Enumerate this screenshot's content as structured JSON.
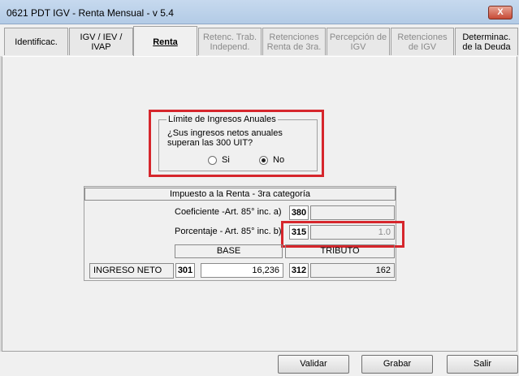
{
  "window": {
    "title": "0621 PDT IGV - Renta Mensual - v 5.4",
    "close_label": "X"
  },
  "tabs": [
    {
      "label": "Identificac."
    },
    {
      "label": "IGV / IEV / IVAP"
    },
    {
      "label": "Renta"
    },
    {
      "label": "Retenc. Trab. Independ."
    },
    {
      "label": "Retenciones Renta de 3ra."
    },
    {
      "label": "Percepción de IGV"
    },
    {
      "label": "Retenciones de IGV"
    },
    {
      "label": "Determinac. de la Deuda"
    }
  ],
  "limite": {
    "legend": "Límite de Ingresos Anuales",
    "question": "¿Sus ingresos netos anuales superan las 300 UIT?",
    "option_si": "Si",
    "option_no": "No",
    "selected": "No"
  },
  "impuesto": {
    "header": "Impuesto a la Renta - 3ra categoría",
    "coeficiente_label": "Coeficiente -Art. 85° inc. a)",
    "coeficiente_code": "380",
    "coeficiente_value": "",
    "porcentaje_label": "Porcentaje - Art. 85° inc. b)",
    "porcentaje_code": "315",
    "porcentaje_value": "1.0",
    "col_base": "BASE",
    "col_tributo": "TRIBUTO",
    "ingreso_label": "INGRESO NETO",
    "base_code": "301",
    "base_value": "16,236",
    "tributo_code": "312",
    "tributo_value": "162"
  },
  "buttons": {
    "validar": "Validar",
    "grabar": "Grabar",
    "salir": "Salir"
  },
  "colors": {
    "highlight": "#d6262c",
    "titlebar": "#c6d9ee"
  }
}
